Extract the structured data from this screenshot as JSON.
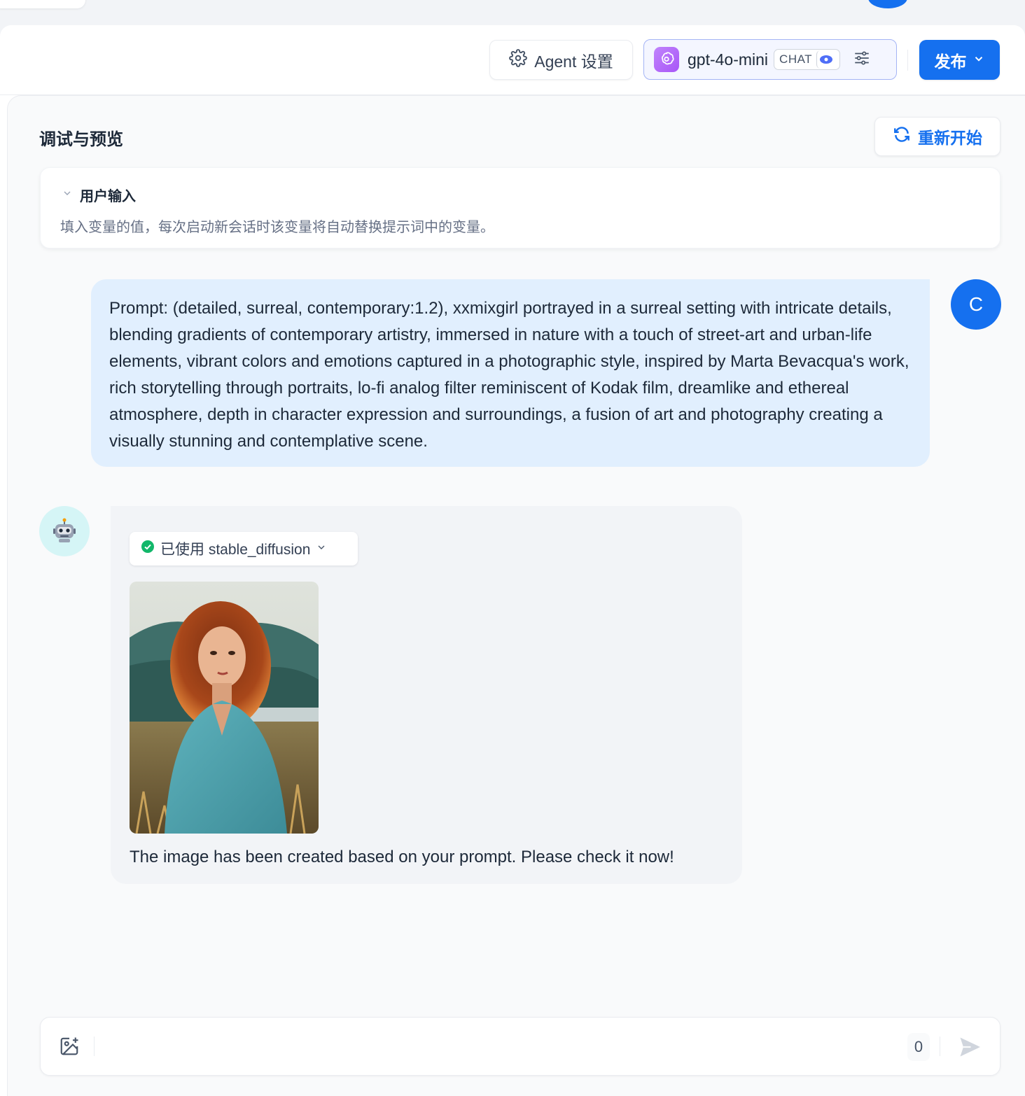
{
  "toolbar": {
    "agent_settings_label": "Agent 设置",
    "model_name": "gpt-4o-mini",
    "model_badge": "CHAT",
    "publish_label": "发布"
  },
  "panel": {
    "title": "调试与预览",
    "restart_label": "重新开始",
    "user_input": {
      "heading": "用户输入",
      "description": "填入变量的值，每次启动新会话时该变量将自动替换提示词中的变量。"
    }
  },
  "conversation": {
    "user": {
      "avatar_initial": "C",
      "message": "Prompt: (detailed, surreal, contemporary:1.2), xxmixgirl portrayed in a surreal setting with intricate details, blending gradients of contemporary artistry, immersed in nature with a touch of street-art and urban-life elements, vibrant colors and emotions captured in a photographic style, inspired by Marta Bevacqua's work, rich storytelling through portraits, lo-fi analog filter reminiscent of Kodak film, dreamlike and ethereal atmosphere, depth in character expression and surroundings, a fusion of art and photography creating a visually stunning and contemplative scene."
    },
    "bot": {
      "avatar_icon": "robot-icon",
      "tool_used_label": "已使用 stable_diffusion",
      "reply": "The image has been created based on your prompt. Please check it now!"
    }
  },
  "composer": {
    "placeholder": "",
    "char_count": "0"
  },
  "colors": {
    "primary": "#1570ef",
    "user_bubble": "#e1effe",
    "bot_bubble": "#f2f4f7",
    "success": "#12b76a"
  }
}
